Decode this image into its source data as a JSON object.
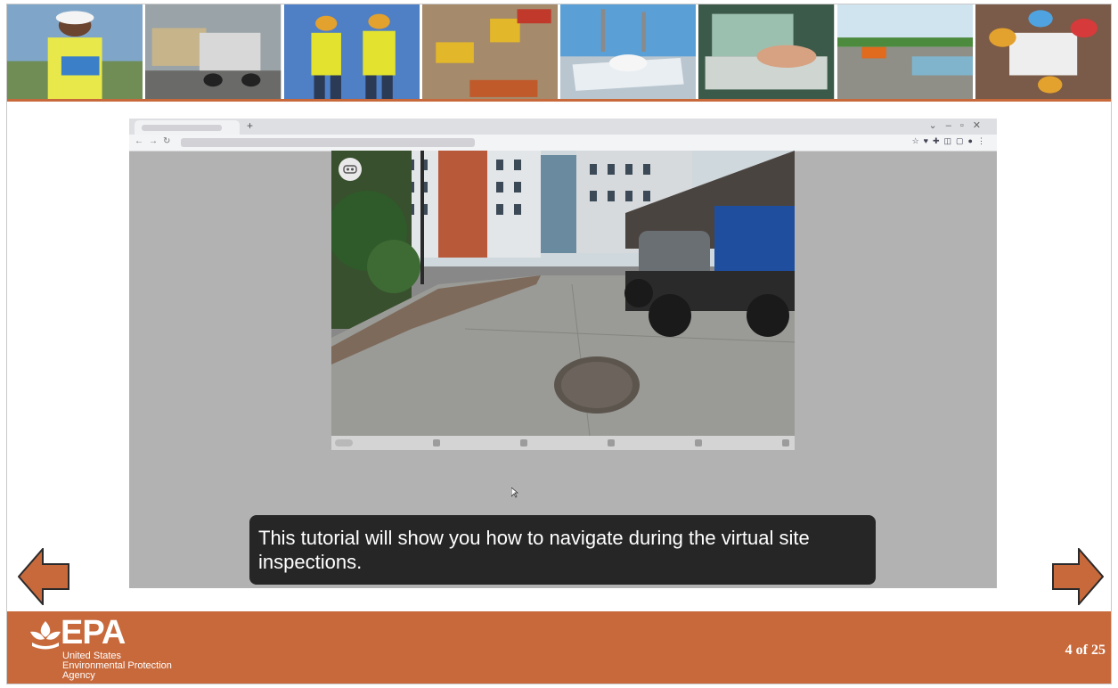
{
  "caption": "This tutorial will show you how to navigate during the virtual site inspections.",
  "footer": {
    "logo_text": "EPA",
    "agency_lines": [
      "United States",
      "Environmental Protection",
      "Agency"
    ],
    "page_counter": "4 of 25"
  },
  "browser": {
    "new_tab_symbol": "+"
  },
  "colors": {
    "accent": "#c8693b",
    "caption_bg": "#262626",
    "video_bg": "#b2b2b2"
  },
  "icons": {
    "prev": "arrow-left-icon",
    "next": "arrow-right-icon",
    "vr": "vr-headset-icon"
  }
}
